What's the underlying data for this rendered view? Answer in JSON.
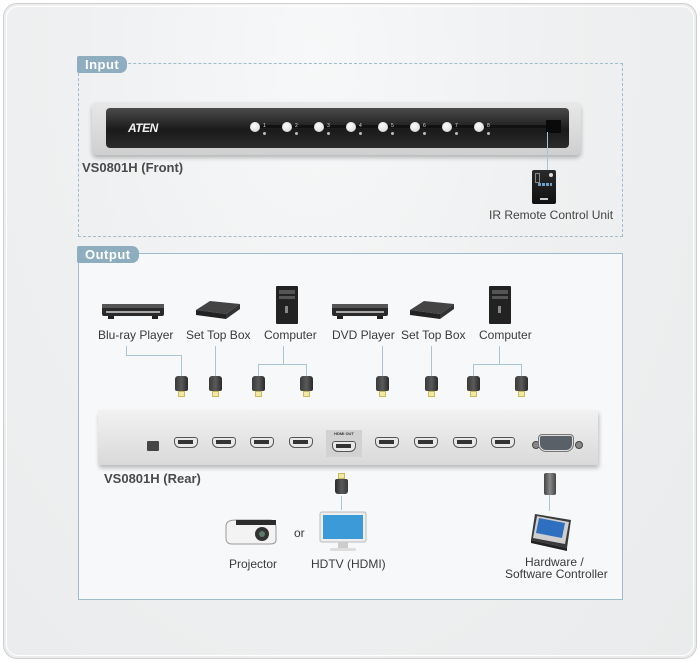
{
  "input_section": {
    "tab_label": "Input",
    "front_device_label": "VS0801H (Front)",
    "brand_logo": "ATEN",
    "port_buttons": [
      "1",
      "2",
      "3",
      "4",
      "5",
      "6",
      "7",
      "8"
    ],
    "remote_label": "IR Remote Control Unit"
  },
  "output_section": {
    "tab_label": "Output",
    "sources": [
      {
        "label": "Blu-ray Player",
        "icon": "bluray-player-icon"
      },
      {
        "label": "Set Top Box",
        "icon": "set-top-box-icon"
      },
      {
        "label": "Computer",
        "icon": "computer-tower-icon"
      },
      {
        "label": "DVD Player",
        "icon": "dvd-player-icon"
      },
      {
        "label": "Set Top Box",
        "icon": "set-top-box-icon"
      },
      {
        "label": "Computer",
        "icon": "computer-tower-icon"
      }
    ],
    "rear_device_label": "VS0801H (Rear)",
    "hdmi_out_label": "HDMI OUT",
    "displays": [
      {
        "label": "Projector",
        "icon": "projector-icon"
      },
      {
        "label": "HDTV (HDMI)",
        "icon": "hdtv-icon"
      }
    ],
    "or_label": "or",
    "controller_label_line1": "Hardware /",
    "controller_label_line2": "Software Controller"
  },
  "colors": {
    "tab_bg": "#8eaec0",
    "border": "#9fbccb",
    "cable": "#a9c4d4"
  }
}
